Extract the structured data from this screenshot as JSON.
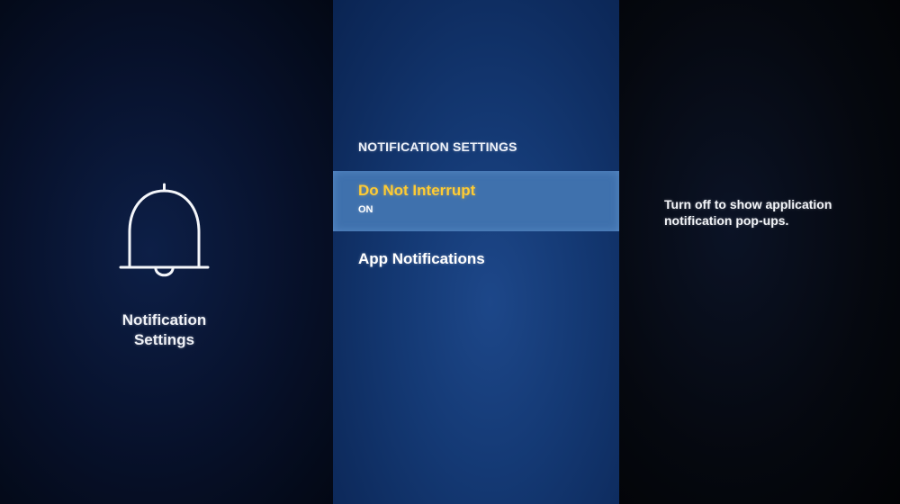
{
  "category": {
    "icon": "bell-icon",
    "label": "Notification Settings"
  },
  "menu": {
    "header": "NOTIFICATION SETTINGS",
    "items": [
      {
        "title": "Do Not Interrupt",
        "value": "ON",
        "selected": true
      },
      {
        "title": "App Notifications"
      }
    ]
  },
  "description": {
    "text": "Turn off to show application notification pop-ups."
  },
  "colors": {
    "highlight_bg": "#3f71ad",
    "selected_text": "#ffcc33",
    "center_bg": "#143974"
  }
}
